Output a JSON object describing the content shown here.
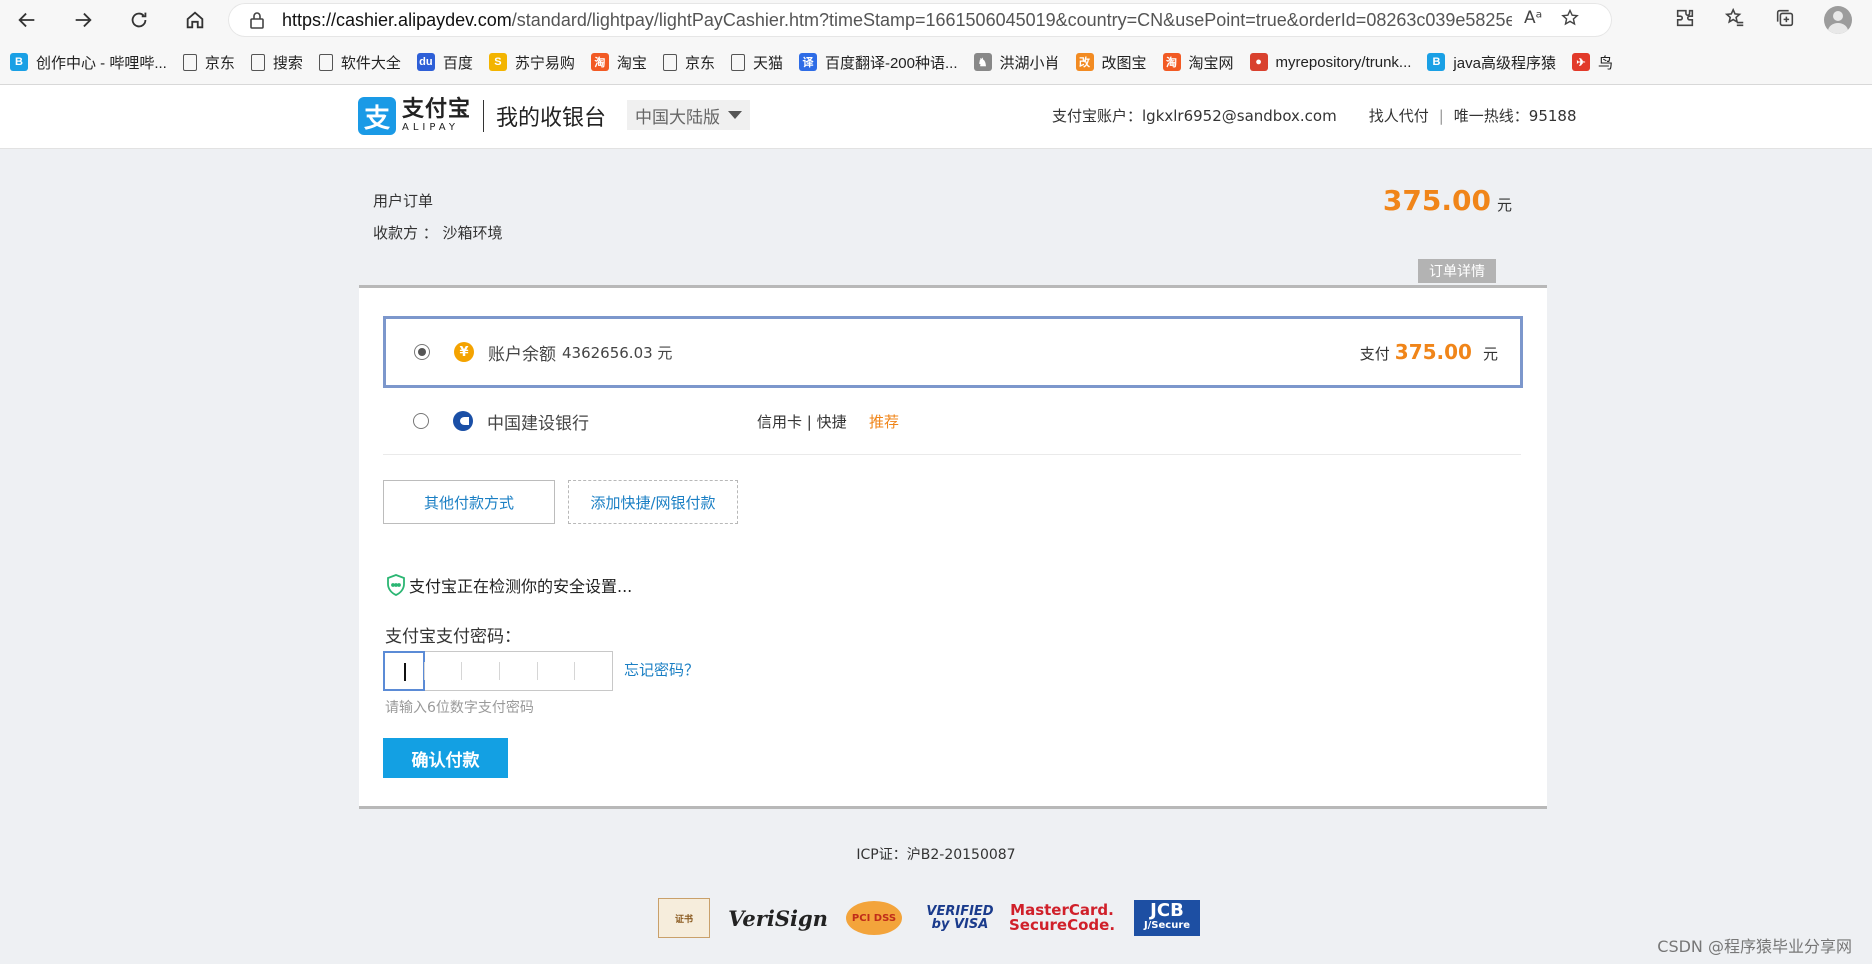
{
  "browser": {
    "url_host": "https://cashier.alipaydev.com",
    "url_rest": "/standard/lightpay/lightPayCashier.htm?timeStamp=1661506045019&country=CN&usePoint=true&orderId=08263c039e5825e...",
    "read_aloud_icon": "Aᵃ",
    "icons": [
      "back-icon",
      "forward-icon",
      "refresh-icon",
      "home-icon",
      "lock-icon",
      "favorite-add-icon",
      "extensions-icon",
      "favorites-icon",
      "collections-icon",
      "profile-avatar"
    ]
  },
  "bookmarks": [
    {
      "label": "创作中心 - 哔哩哔...",
      "icon": "bilibili-icon",
      "color": "#1aa0e5",
      "glyph": "B"
    },
    {
      "label": "京东",
      "icon": "page-icon"
    },
    {
      "label": "搜索",
      "icon": "page-icon"
    },
    {
      "label": "软件大全",
      "icon": "page-icon"
    },
    {
      "label": "百度",
      "icon": "baidu-icon",
      "color": "#2e5fd7",
      "glyph": "du"
    },
    {
      "label": "苏宁易购",
      "icon": "suning-icon",
      "color": "#f3b400",
      "glyph": "S"
    },
    {
      "label": "淘宝",
      "icon": "taobao-icon",
      "color": "#f25a24",
      "glyph": "淘"
    },
    {
      "label": "京东",
      "icon": "page-icon"
    },
    {
      "label": "天猫",
      "icon": "page-icon"
    },
    {
      "label": "百度翻译-200种语...",
      "icon": "baidu-translate-icon",
      "color": "#2e6ce6",
      "glyph": "译"
    },
    {
      "label": "洪湖小肖",
      "icon": "bird-icon",
      "color": "#888888",
      "glyph": "♞"
    },
    {
      "label": "改图宝",
      "icon": "gaitubao-icon",
      "color": "#f28b22",
      "glyph": "改"
    },
    {
      "label": "淘宝网",
      "icon": "taobao-icon",
      "color": "#f25a24",
      "glyph": "淘"
    },
    {
      "label": "myrepository/trunk...",
      "icon": "chrome-icon",
      "color": "#d9412e",
      "glyph": "●"
    },
    {
      "label": "java高级程序猿",
      "icon": "bilibili-icon",
      "color": "#1aa0e5",
      "glyph": "B"
    },
    {
      "label": "鸟",
      "icon": "bird-red-icon",
      "color": "#e23a2a",
      "glyph": "✈"
    }
  ],
  "header": {
    "logo_cn": "支付宝",
    "logo_en": "ALIPAY",
    "logo_glyph": "支",
    "title": "我的收银台",
    "region": "中国大陆版",
    "account_label": "支付宝账户：lgkxlr6952@sandbox.com",
    "find_payer": "找人代付",
    "divider": "|",
    "hotline": "唯一热线：95188"
  },
  "order": {
    "title": "用户订单",
    "payee": "收款方 ： 沙箱环境",
    "amount": "375.00",
    "unit": "元",
    "detail_button": "订单详情"
  },
  "payment": {
    "balance_option": {
      "icon_glyph": "¥",
      "label": "账户余额",
      "balance": "4362656.03 元",
      "pay_label": "支付",
      "pay_amount": "375.00",
      "pay_unit": "元",
      "selected": true
    },
    "bank_option": {
      "label": "中国建设银行",
      "tags": "信用卡 | 快捷",
      "badge": "推荐",
      "selected": false
    },
    "other_methods": "其他付款方式",
    "add_quick": "添加快捷/网银付款",
    "security_note": "支付宝正在检测你的安全设置...",
    "password_label": "支付宝支付密码：",
    "forgot_password": "忘记密码？",
    "password_hint": "请输入6位数字支付密码",
    "confirm": "确认付款"
  },
  "footer": {
    "icp": "ICP证：沪B2-20150087",
    "badges": {
      "cert": "证书",
      "verisign": "VeriSign",
      "pci": "PCI DSS",
      "visa_line1": "VERIFIED",
      "visa_line2": "by VISA",
      "mc_line1": "MasterCard.",
      "mc_line2": "SecureCode.",
      "jcb_line1": "JCB",
      "jcb_line2": "J/Secure"
    }
  },
  "watermark": "CSDN @程序猿毕业分享网",
  "colors": {
    "accent": "#f08519",
    "link": "#1a7fc4",
    "primary_button": "#13a0e3",
    "selected_border": "#7c97cc"
  }
}
